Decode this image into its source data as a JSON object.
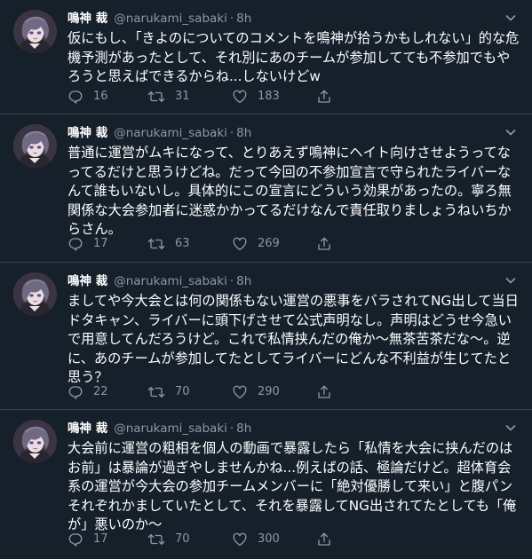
{
  "colors": {
    "background": "#15202b",
    "border": "#38444d",
    "muted": "#8899a6",
    "text": "#ffffff"
  },
  "icons": {
    "reply": "reply-icon",
    "retweet": "retweet-icon",
    "like": "heart-icon",
    "share": "share-icon",
    "more": "chevron-down-icon"
  },
  "tweets": [
    {
      "name": "鳴神 裁",
      "handle": "@narukami_sabaki",
      "dot": "·",
      "time": "8h",
      "text": "仮にもし、「きよのについてのコメントを鳴神が拾うかもしれない」的な危機予測があったとして、それ別にあのチームが参加してても不参加でもやろうと思えばできるからね...しないけどw",
      "replies": "16",
      "retweets": "31",
      "likes": "183"
    },
    {
      "name": "鳴神 裁",
      "handle": "@narukami_sabaki",
      "dot": "·",
      "time": "8h",
      "text": "普通に運営がムキになって、とりあえず鳴神にヘイト向けさせようってなってるだけと思うけどね。だって今回の不参加宣言で守られたライバーなんて誰もいないし。具体的にこの宣言にどういう効果があったの。寧ろ無関係な大会参加者に迷惑かかってるだけなんで責任取りましょうねいちからさん。",
      "replies": "17",
      "retweets": "63",
      "likes": "269"
    },
    {
      "name": "鳴神 裁",
      "handle": "@narukami_sabaki",
      "dot": "·",
      "time": "8h",
      "text": "ましてや今大会とは何の関係もない運営の悪事をバラされてNG出して当日ドタキャン、ライバーに頭下げさせて公式声明なし。声明はどうせ今急いで用意してんだろうけど。これで私情挟んだの俺か〜無茶苦茶だな〜。逆に、あのチームが参加してたとしてライバーにどんな不利益が生じてたと思う？",
      "replies": "22",
      "retweets": "70",
      "likes": "290"
    },
    {
      "name": "鳴神 裁",
      "handle": "@narukami_sabaki",
      "dot": "·",
      "time": "8h",
      "text": "大会前に運営の粗相を個人の動画で暴露したら「私情を大会に挟んだのはお前」は暴論が過ぎやしませんかね...例えばの話、極論だけど。超体育会系の運営が今大会の参加チームメンバーに「絶対優勝して来い」と腹パンそれぞれかましていたとして、それを暴露してNG出されてたとしても「俺が」悪いのか〜",
      "replies": "17",
      "retweets": "70",
      "likes": "300"
    }
  ]
}
